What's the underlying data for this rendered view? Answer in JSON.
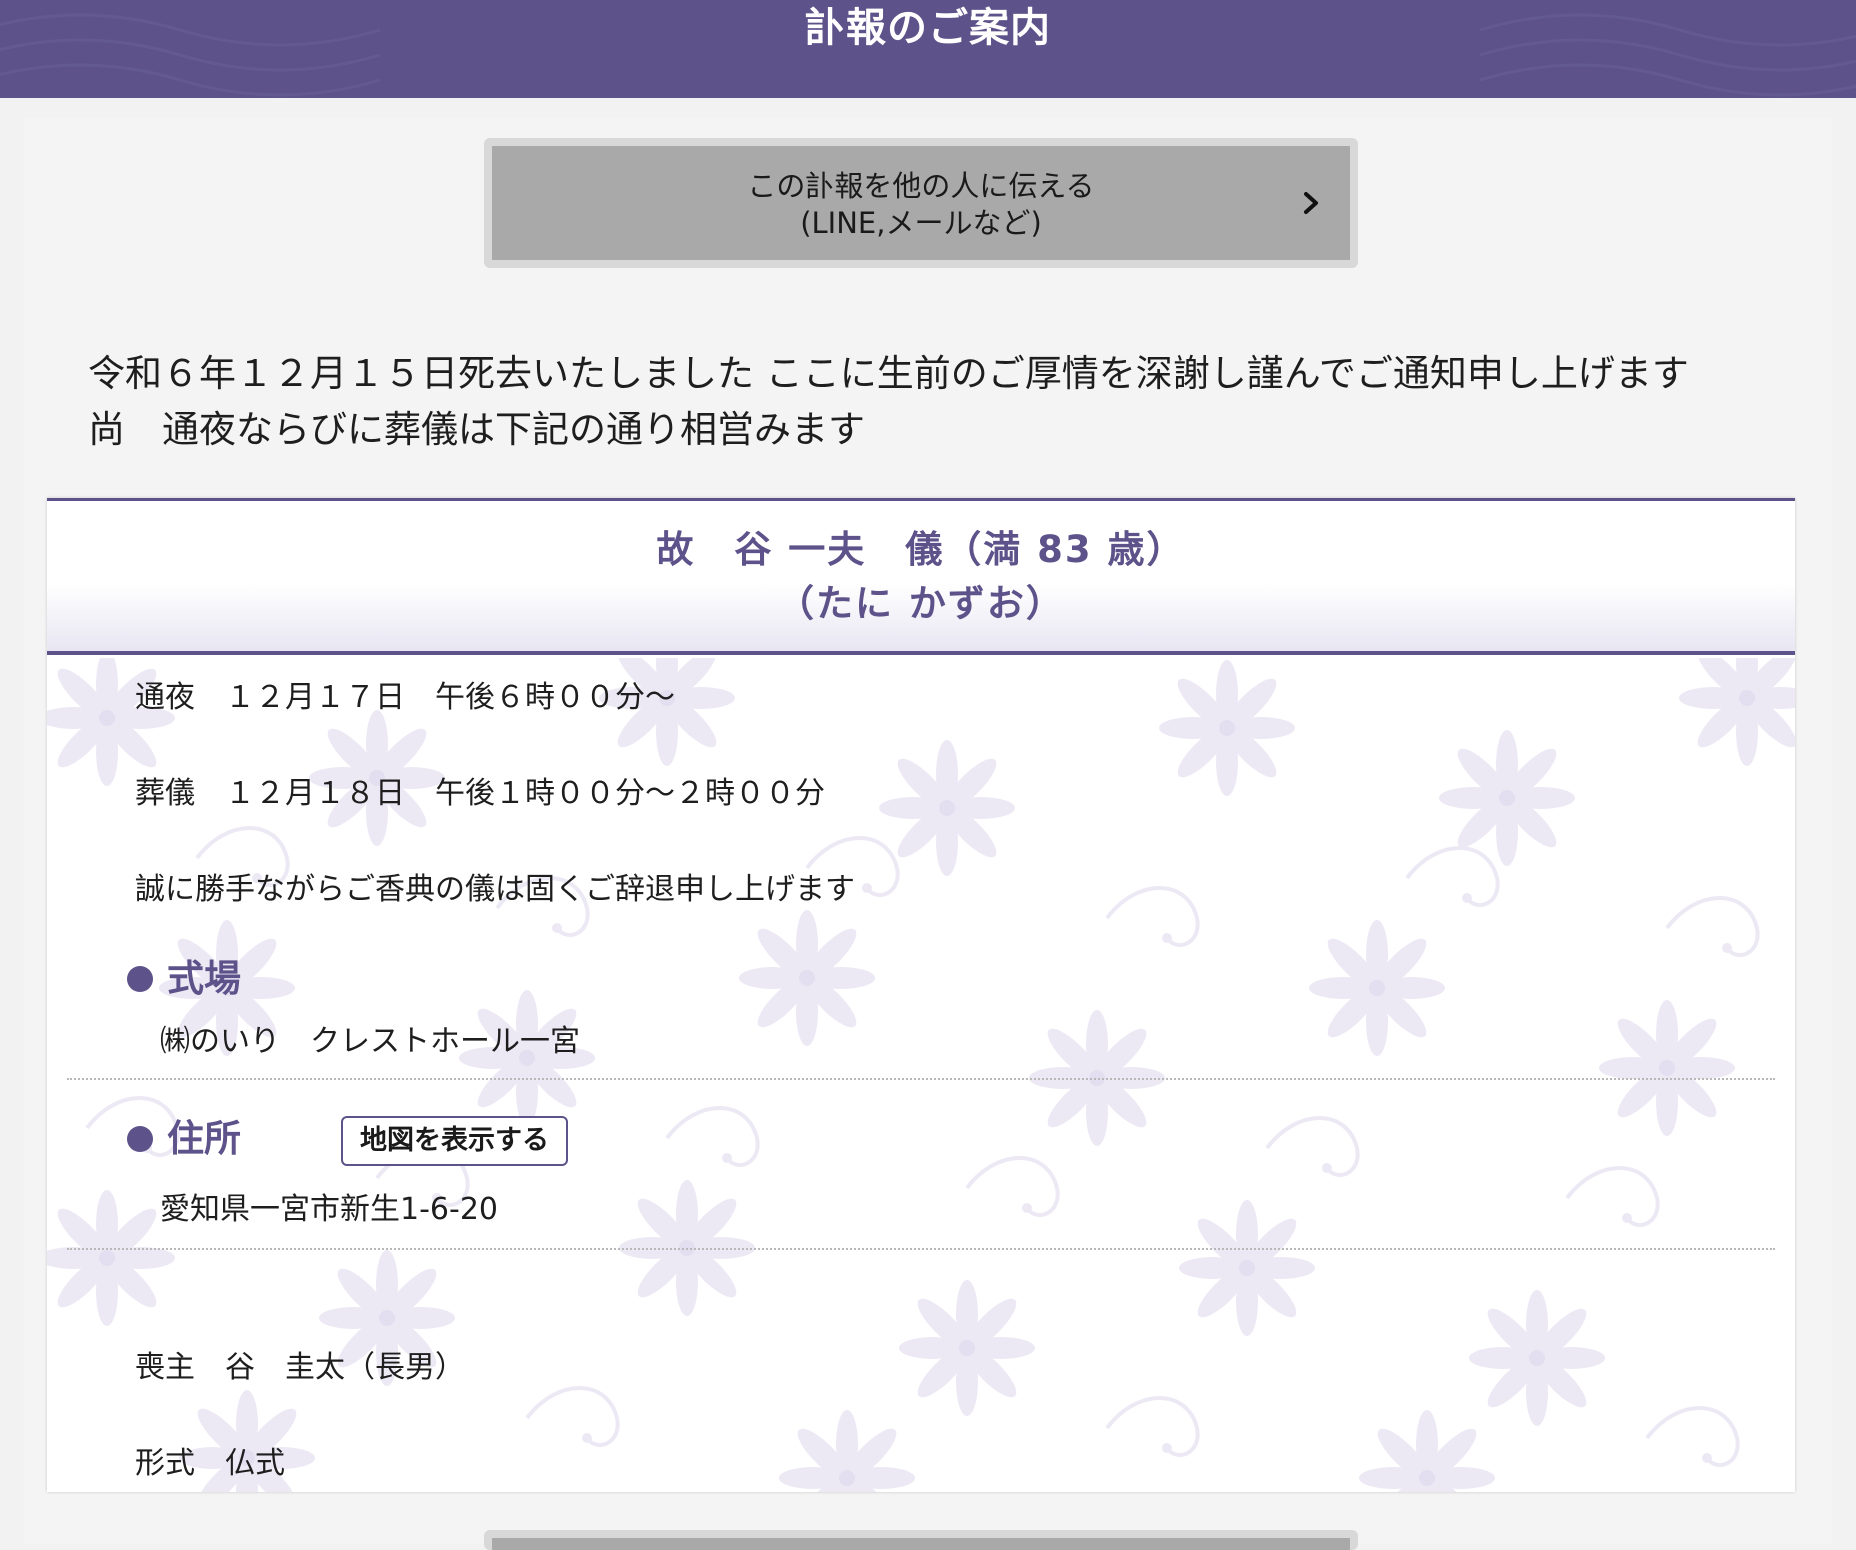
{
  "header": {
    "title": "訃報のご案内"
  },
  "share": {
    "line1": "この訃報を他の人に伝える",
    "line2": "(LINE,メールなど)"
  },
  "intro": {
    "line1": "令和６年１２月１５日死去いたしました ここに生前のご厚情を深謝し謹んでご通知申し上げます",
    "line2": "尚　通夜ならびに葬儀は下記の通り相営みます"
  },
  "deceased": {
    "name": "故　谷 一夫　儀（満 83 歳）",
    "reading": "（たに かずお）"
  },
  "schedule": {
    "wake": "通夜　１２月１７日　午後６時００分〜",
    "funeral": "葬儀　１２月１８日　午後１時００分〜２時００分",
    "notice": "誠に勝手ながらご香典の儀は固くご辞退申し上げます"
  },
  "venue": {
    "heading": "式場",
    "name": "㈱のいり　クレストホール一宮"
  },
  "address": {
    "heading": "住所",
    "map_button": "地図を表示する",
    "value": "愛知県一宮市新生1-6-20"
  },
  "chief_mourner": "喪主　谷　圭太（長男）",
  "ceremony_form": "形式　仏式",
  "colors": {
    "accent": "#5d5289",
    "button_gray": "#a9a9a9"
  }
}
